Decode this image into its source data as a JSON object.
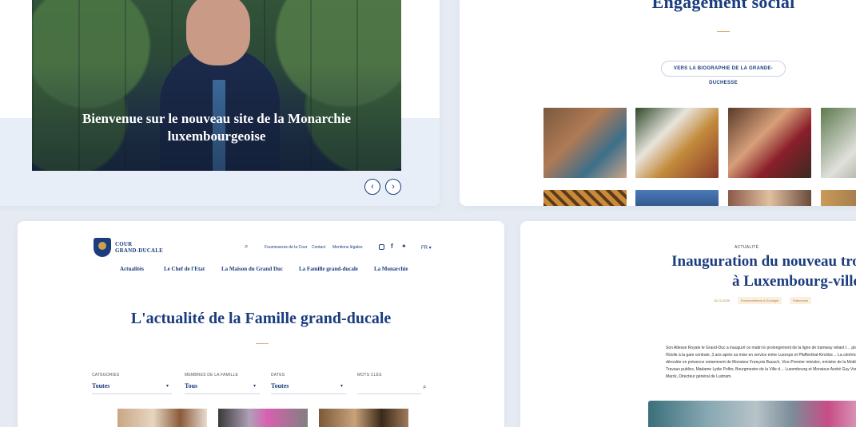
{
  "hero": {
    "caption": "Bienvenue sur le nouveau site de la Monarchie luxembourgeoise",
    "prev_icon": "chevron-left-icon",
    "next_icon": "chevron-right-icon",
    "prev_glyph": "‹",
    "next_glyph": "›"
  },
  "social": {
    "title": "Engagement social",
    "button_label": "VERS LA BIOGRAPHIE DE LA GRANDE-DUCHESSE"
  },
  "news": {
    "logo_line1": "COUR",
    "logo_line2": "GRAND-DUCALE",
    "utility_links": [
      "Fournisseurs de la Cour",
      "Contact",
      "Mentions légales"
    ],
    "language": "FR",
    "nav": [
      "Actualités",
      "Le Chef de l'Etat",
      "La Maison du Grand Duc",
      "La Famille grand-ducale",
      "La Monarchie"
    ],
    "heading": "L'actualité de la Famille grand-ducale",
    "filters": [
      {
        "label": "CATÉGORIES",
        "value": "Toutes"
      },
      {
        "label": "MEMBRES DE LA FAMILLE",
        "value": "Tous"
      },
      {
        "label": "DATES",
        "value": "Toutes"
      }
    ],
    "search_label": "MOTS CLÉS",
    "search_placeholder": ""
  },
  "article": {
    "kicker": "ACTUALITÉ",
    "title_line1": "Inauguration du nouveau tronçon du t",
    "title_line2": "à Luxembourg-ville",
    "date": "15.12.2020",
    "tags": [
      "Environnement & Ecologie",
      "Patrimoine"
    ],
    "body": "Son Altesse Royale le Grand-Duc a inauguré ce matin le prolongement de la ligne de tramway reliant l… place de l'Etoile à la gare centrale, 3 ans après sa mise en service entre Luxexpo et Pfaffenthal-Kirchbe… La cérémonie s'est déroulée en présence notamment de Monsieur François Bausch, Vice-Premier ministre, ministre de la Mobilité et des Travaux publics, Madame Lydie Polfer, Bourgmestre de la Ville d… Luxembourg et Monsieur André Guy Von der Marck, Directeur général de Luxtram."
  },
  "colors": {
    "navy": "#1b3d7e",
    "gold": "#d9b27a",
    "background": "#e6ebf3"
  }
}
